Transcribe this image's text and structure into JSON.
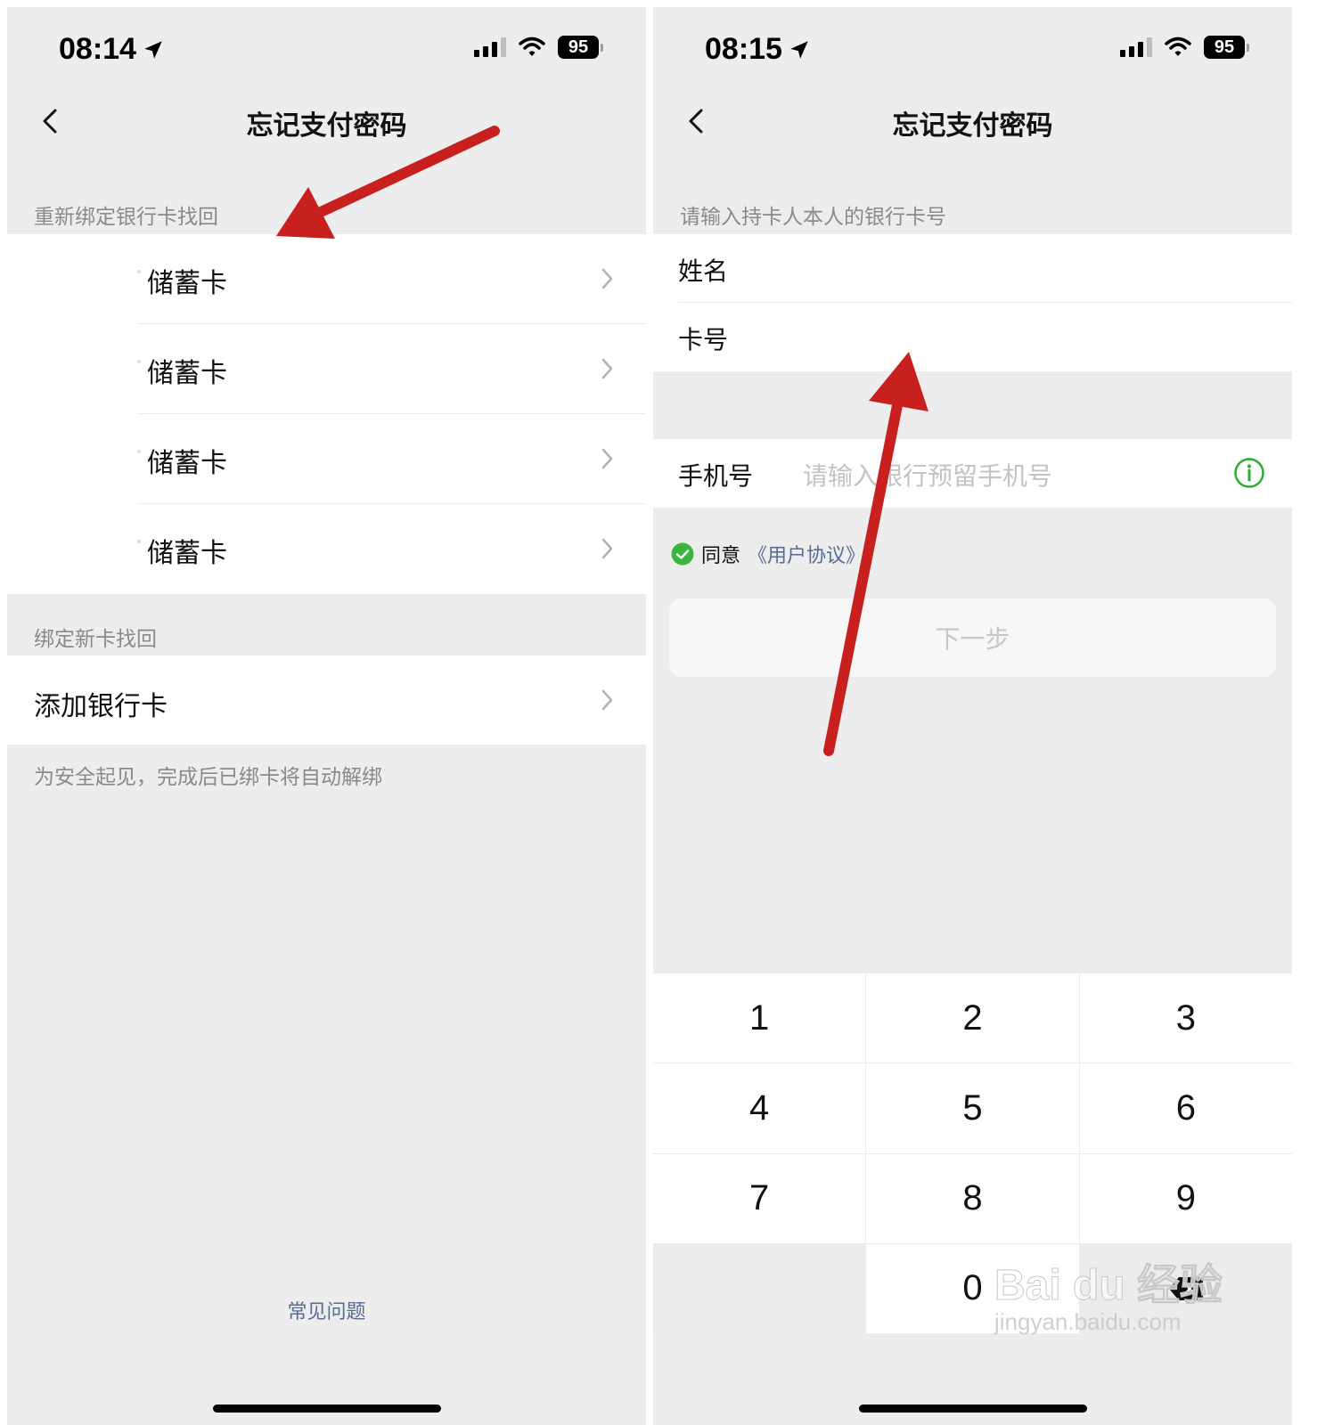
{
  "left": {
    "status": {
      "time": "08:14",
      "battery": "95"
    },
    "title": "忘记支付密码",
    "section1_label": "重新绑定银行卡找回",
    "cards": [
      {
        "label": "储蓄卡"
      },
      {
        "label": "储蓄卡"
      },
      {
        "label": "储蓄卡"
      },
      {
        "label": "储蓄卡"
      }
    ],
    "section2_label": "绑定新卡找回",
    "add_card": "添加银行卡",
    "hint": "为安全起见，完成后已绑卡将自动解绑",
    "faq": "常见问题"
  },
  "right": {
    "status": {
      "time": "08:15",
      "battery": "95"
    },
    "title": "忘记支付密码",
    "section_label": "请输入持卡人本人的银行卡号",
    "name_label": "姓名",
    "card_label": "卡号",
    "phone_label": "手机号",
    "phone_placeholder": "请输入银行预留手机号",
    "agree_text": "同意",
    "agreement_link": "《用户协议》",
    "next_button": "下一步",
    "keypad": [
      "1",
      "2",
      "3",
      "4",
      "5",
      "6",
      "7",
      "8",
      "9",
      "0"
    ]
  },
  "watermark": {
    "main": "Bai du 经验",
    "sub": "jingyan.baidu.com"
  },
  "colors": {
    "arrow": "#c8201e",
    "link": "#576b95",
    "green": "#07c160",
    "background": "#ededed"
  },
  "icons": [
    "back-icon",
    "chevron-right-icon",
    "location-arrow-icon",
    "signal-icon",
    "wifi-icon",
    "battery-icon",
    "info-icon",
    "check-circle-icon",
    "backspace-icon"
  ]
}
